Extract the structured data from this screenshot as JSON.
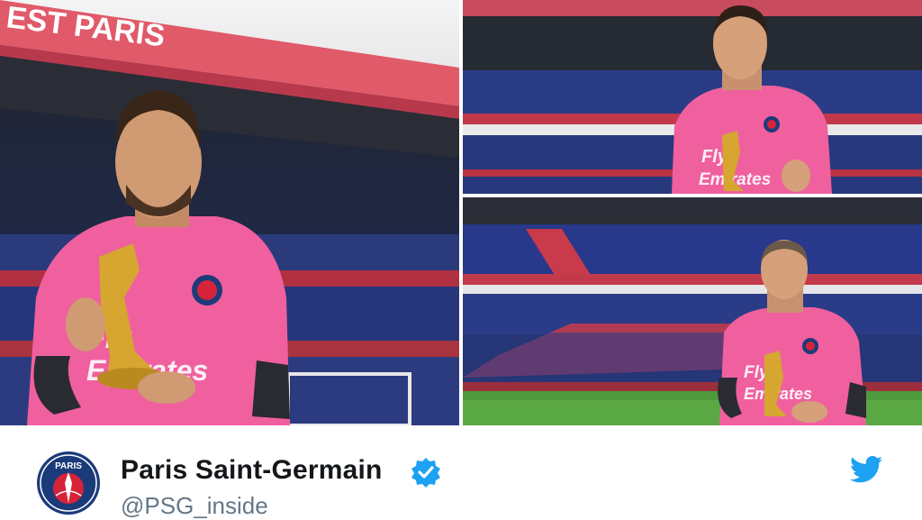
{
  "photos": {
    "left_banner_text": "EST PARIS"
  },
  "tweet": {
    "account_name": "Paris Saint-Germain",
    "handle": "@PSG_inside",
    "avatar_text": "PARIS",
    "verified": true
  },
  "icons": {
    "avatar": "psg-crest-icon",
    "verified": "verified-badge-icon",
    "twitter": "twitter-bird-icon"
  },
  "colors": {
    "shirt_pink": "#f0609e",
    "twitter_blue": "#1da1f2",
    "name_text": "#14171a",
    "handle_text": "#657786",
    "psg_navy": "#1b3a7a",
    "psg_red": "#d7233a"
  }
}
